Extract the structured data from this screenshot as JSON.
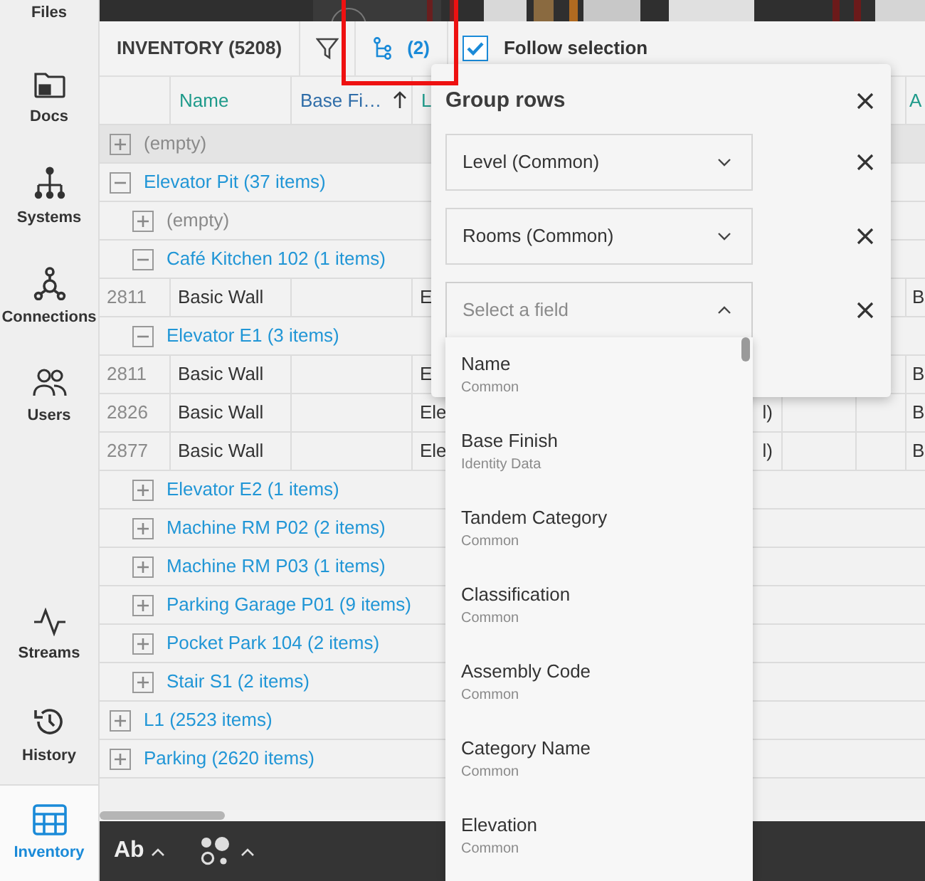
{
  "sidebar": {
    "items": [
      {
        "label": "Files",
        "selected": false
      },
      {
        "label": "Docs",
        "selected": false
      },
      {
        "label": "Systems",
        "selected": false
      },
      {
        "label": "Connections",
        "selected": false
      },
      {
        "label": "Users",
        "selected": false
      },
      {
        "label": "Streams",
        "selected": false
      },
      {
        "label": "History",
        "selected": false
      },
      {
        "label": "Inventory",
        "selected": true
      }
    ]
  },
  "toolbar": {
    "title": "INVENTORY (5208)",
    "group_count": "(2)",
    "follow_selection": {
      "label": "Follow selection",
      "checked": true
    }
  },
  "table": {
    "columns": [
      {
        "label": "Name",
        "sorted": false
      },
      {
        "label": "Base Fi…",
        "sorted": true
      },
      {
        "label": "L",
        "sorted": false
      },
      {
        "label": "A",
        "sorted": false
      }
    ],
    "rows": [
      {
        "kind": "group",
        "label": "(empty)",
        "muted": true,
        "expanded": false,
        "hovered": true
      },
      {
        "kind": "group",
        "label": "Elevator Pit (37 items)",
        "muted": false,
        "expanded": true,
        "hovered": false,
        "children": [
          {
            "kind": "group",
            "label": "(empty)",
            "muted": true,
            "expanded": false,
            "hovered": false
          },
          {
            "kind": "group",
            "label": "Café Kitchen 102 (1 items)",
            "muted": false,
            "expanded": true,
            "hovered": false,
            "children": [
              {
                "kind": "item",
                "id": "2811",
                "name": "Basic Wall",
                "column_3": {
                  "start": "E"
                },
                "column_6": "B",
                "hovered": false
              }
            ]
          },
          {
            "kind": "group",
            "label": "Elevator E1 (3 items)",
            "muted": false,
            "expanded": true,
            "hovered": false,
            "children": [
              {
                "kind": "item",
                "id": "2811",
                "name": "Basic Wall",
                "column_3": {
                  "start": "E"
                },
                "column_6": "B",
                "hovered": false
              },
              {
                "kind": "item",
                "id": "2826",
                "name": "Basic Wall",
                "column_3": {
                  "start": "Ele",
                  "end": "l)"
                },
                "column_6": "B",
                "hovered": false
              },
              {
                "kind": "item",
                "id": "2877",
                "name": "Basic Wall",
                "column_3": {
                  "start": "Ele",
                  "end": "l)"
                },
                "column_6": "B",
                "hovered": false
              }
            ]
          },
          {
            "kind": "group",
            "label": "Elevator E2 (1 items)",
            "muted": false,
            "expanded": false,
            "hovered": false
          },
          {
            "kind": "group",
            "label": "Machine RM P02 (2 items)",
            "muted": false,
            "expanded": false,
            "hovered": false
          },
          {
            "kind": "group",
            "label": "Machine RM P03 (1 items)",
            "muted": false,
            "expanded": false,
            "hovered": false
          },
          {
            "kind": "group",
            "label": "Parking Garage P01 (9 items)",
            "muted": false,
            "expanded": false,
            "hovered": false
          },
          {
            "kind": "group",
            "label": "Pocket Park 104 (2 items)",
            "muted": false,
            "expanded": false,
            "hovered": false
          },
          {
            "kind": "group",
            "label": "Stair S1 (2 items)",
            "muted": false,
            "expanded": false,
            "hovered": false
          }
        ]
      },
      {
        "kind": "group",
        "label": "L1 (2523 items)",
        "muted": false,
        "expanded": false,
        "hovered": false
      },
      {
        "kind": "group",
        "label": "Parking (2620 items)",
        "muted": false,
        "expanded": false,
        "hovered": false
      }
    ]
  },
  "bottom_bar": {
    "text_button": "Ab"
  },
  "group_rows_panel": {
    "title": "Group rows",
    "fields": [
      {
        "value": "Level (Common)",
        "expanded": false
      },
      {
        "value": "Rooms (Common)",
        "expanded": false
      },
      {
        "placeholder": "Select a field",
        "expanded": true
      }
    ],
    "options": [
      {
        "name": "Name",
        "category": "Common"
      },
      {
        "name": "Base Finish",
        "category": "Identity Data"
      },
      {
        "name": "Tandem Category",
        "category": "Common"
      },
      {
        "name": "Classification",
        "category": "Common"
      },
      {
        "name": "Assembly Code",
        "category": "Common"
      },
      {
        "name": "Category Name",
        "category": "Common"
      },
      {
        "name": "Elevation",
        "category": "Common"
      }
    ]
  }
}
